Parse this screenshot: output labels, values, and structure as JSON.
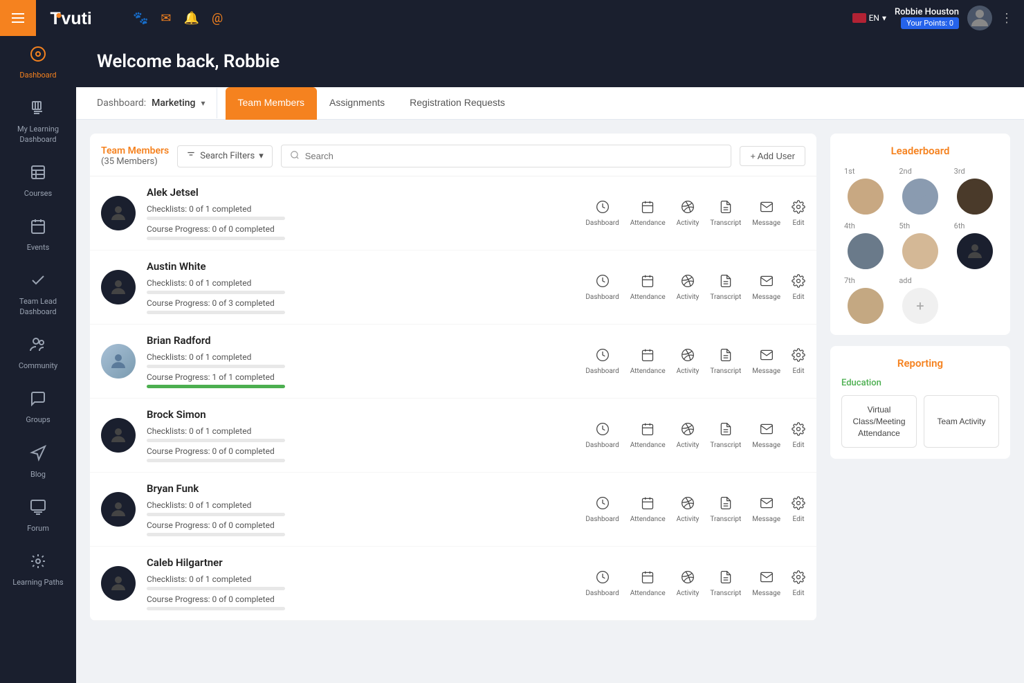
{
  "app": {
    "name": "Tovuti"
  },
  "topbar": {
    "hamburger_label": "menu",
    "icons": [
      "paw-icon",
      "mail-icon",
      "bell-icon",
      "mention-icon"
    ],
    "user": {
      "name": "Robbie Houston",
      "points_label": "Your Points: 0"
    },
    "lang": "EN"
  },
  "sidebar": {
    "items": [
      {
        "id": "dashboard",
        "label": "Dashboard",
        "icon": "⊙"
      },
      {
        "id": "my-learning",
        "label": "My Learning Dashboard",
        "icon": "📚"
      },
      {
        "id": "courses",
        "label": "Courses",
        "icon": "📖"
      },
      {
        "id": "events",
        "label": "Events",
        "icon": "📅"
      },
      {
        "id": "team-lead",
        "label": "Team Lead Dashboard",
        "icon": "✔"
      },
      {
        "id": "community",
        "label": "Community",
        "icon": "👥"
      },
      {
        "id": "groups",
        "label": "Groups",
        "icon": "💬"
      },
      {
        "id": "blog",
        "label": "Blog",
        "icon": "📢"
      },
      {
        "id": "forum",
        "label": "Forum",
        "icon": "💭"
      },
      {
        "id": "learning-paths",
        "label": "Learning Paths",
        "icon": "🔄"
      }
    ]
  },
  "welcome": {
    "title": "Welcome back, Robbie"
  },
  "tabs": {
    "dashboard_label": "Dashboard:",
    "dashboard_value": "Marketing",
    "items": [
      {
        "id": "team-members",
        "label": "Team Members",
        "active": true
      },
      {
        "id": "assignments",
        "label": "Assignments"
      },
      {
        "id": "registration-requests",
        "label": "Registration Requests"
      }
    ]
  },
  "members_section": {
    "title": "Team Members",
    "count": "(35 Members)",
    "filter_label": "Search Filters",
    "search_placeholder": "Search",
    "add_user_label": "+ Add User",
    "members": [
      {
        "name": "Alek Jetsel",
        "checklist": "Checklists: 0 of 1 completed",
        "course_progress": "Course Progress: 0 of 0 completed",
        "checklist_pct": 0,
        "course_pct": 0,
        "has_photo": false,
        "photo_bg": "dark"
      },
      {
        "name": "Austin White",
        "checklist": "Checklists: 0 of 1 completed",
        "course_progress": "Course Progress: 0 of 3 completed",
        "checklist_pct": 0,
        "course_pct": 0,
        "has_photo": false,
        "photo_bg": "dark"
      },
      {
        "name": "Brian Radford",
        "checklist": "Checklists: 0 of 1 completed",
        "course_progress": "Course Progress: 1 of 1 completed",
        "checklist_pct": 0,
        "course_pct": 100,
        "has_photo": true,
        "photo_bg": "person"
      },
      {
        "name": "Brock Simon",
        "checklist": "Checklists: 0 of 1 completed",
        "course_progress": "Course Progress: 0 of 0 completed",
        "checklist_pct": 0,
        "course_pct": 0,
        "has_photo": false,
        "photo_bg": "dark"
      },
      {
        "name": "Bryan Funk",
        "checklist": "Checklists: 0 of 1 completed",
        "course_progress": "Course Progress: 0 of 0 completed",
        "checklist_pct": 0,
        "course_pct": 0,
        "has_photo": false,
        "photo_bg": "dark"
      },
      {
        "name": "Caleb Hilgartner",
        "checklist": "Checklists: 0 of 1 completed",
        "course_progress": "Course Progress: 0 of 0 completed",
        "checklist_pct": 0,
        "course_pct": 0,
        "has_photo": false,
        "photo_bg": "dark"
      }
    ],
    "actions": [
      "Dashboard",
      "Attendance",
      "Activity",
      "Transcript",
      "Message",
      "Edit"
    ]
  },
  "leaderboard": {
    "title": "Leaderboard",
    "ranks": [
      {
        "rank": "1st",
        "has_photo": true,
        "bg": "#c8a882"
      },
      {
        "rank": "2nd",
        "has_photo": true,
        "bg": "#8a9bb0"
      },
      {
        "rank": "3rd",
        "has_photo": true,
        "bg": "#5a4a3a"
      },
      {
        "rank": "4th",
        "has_photo": true,
        "bg": "#6a7a8a"
      },
      {
        "rank": "5th",
        "has_photo": true,
        "bg": "#d4b896"
      },
      {
        "rank": "6th",
        "has_photo": false,
        "bg": "#1a1f2e"
      },
      {
        "rank": "7th",
        "has_photo": true,
        "bg": "#c4a882"
      },
      {
        "rank": "add",
        "has_photo": false,
        "bg": "#f0f0f0"
      }
    ]
  },
  "reporting": {
    "title": "Reporting",
    "section_label": "Education",
    "btn1": "Virtual Class/Meeting Attendance",
    "btn2": "Team Activity"
  }
}
